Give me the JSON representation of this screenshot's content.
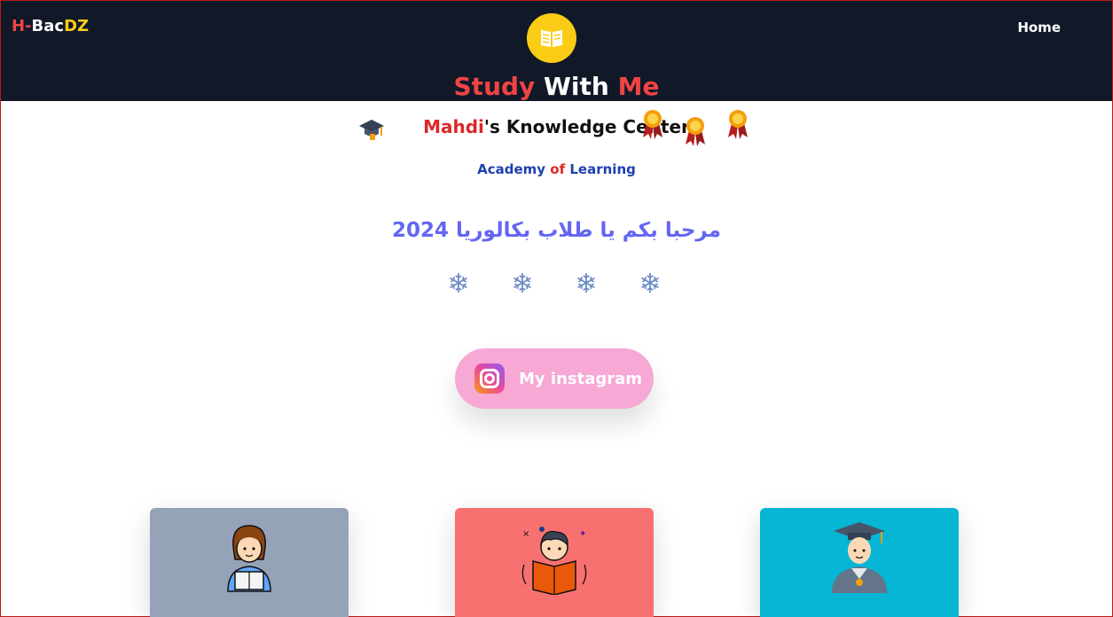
{
  "header": {
    "brand": {
      "part1": "H-",
      "part2": "Bac",
      "part3": "DZ"
    },
    "nav_home": "Home",
    "title": {
      "word1": "Study",
      "word2": "With",
      "word3": "Me"
    },
    "logo_icon": "open-book-icon"
  },
  "main": {
    "knowledge": {
      "name": "Mahdi",
      "rest": "'s Knowledge Center"
    },
    "academy": {
      "word1": "Academy",
      "word2": "of",
      "word3": "Learning"
    },
    "welcome": "مرحبا بكم يا طلاب بكالوريا 2024",
    "snowflake": "❄",
    "instagram_label": "My instagram"
  },
  "cards": [
    {
      "color": "#94a3b8",
      "icon": "student-girl-reading-icon"
    },
    {
      "color": "#f87171",
      "icon": "boy-reading-book-icon"
    },
    {
      "color": "#06b6d4",
      "icon": "graduate-icon"
    }
  ],
  "colors": {
    "header_bg": "#111827",
    "accent_red": "#ef4444",
    "accent_yellow": "#facc15",
    "welcome": "#6366f1",
    "instagram_btn": "#f7a8d4"
  }
}
